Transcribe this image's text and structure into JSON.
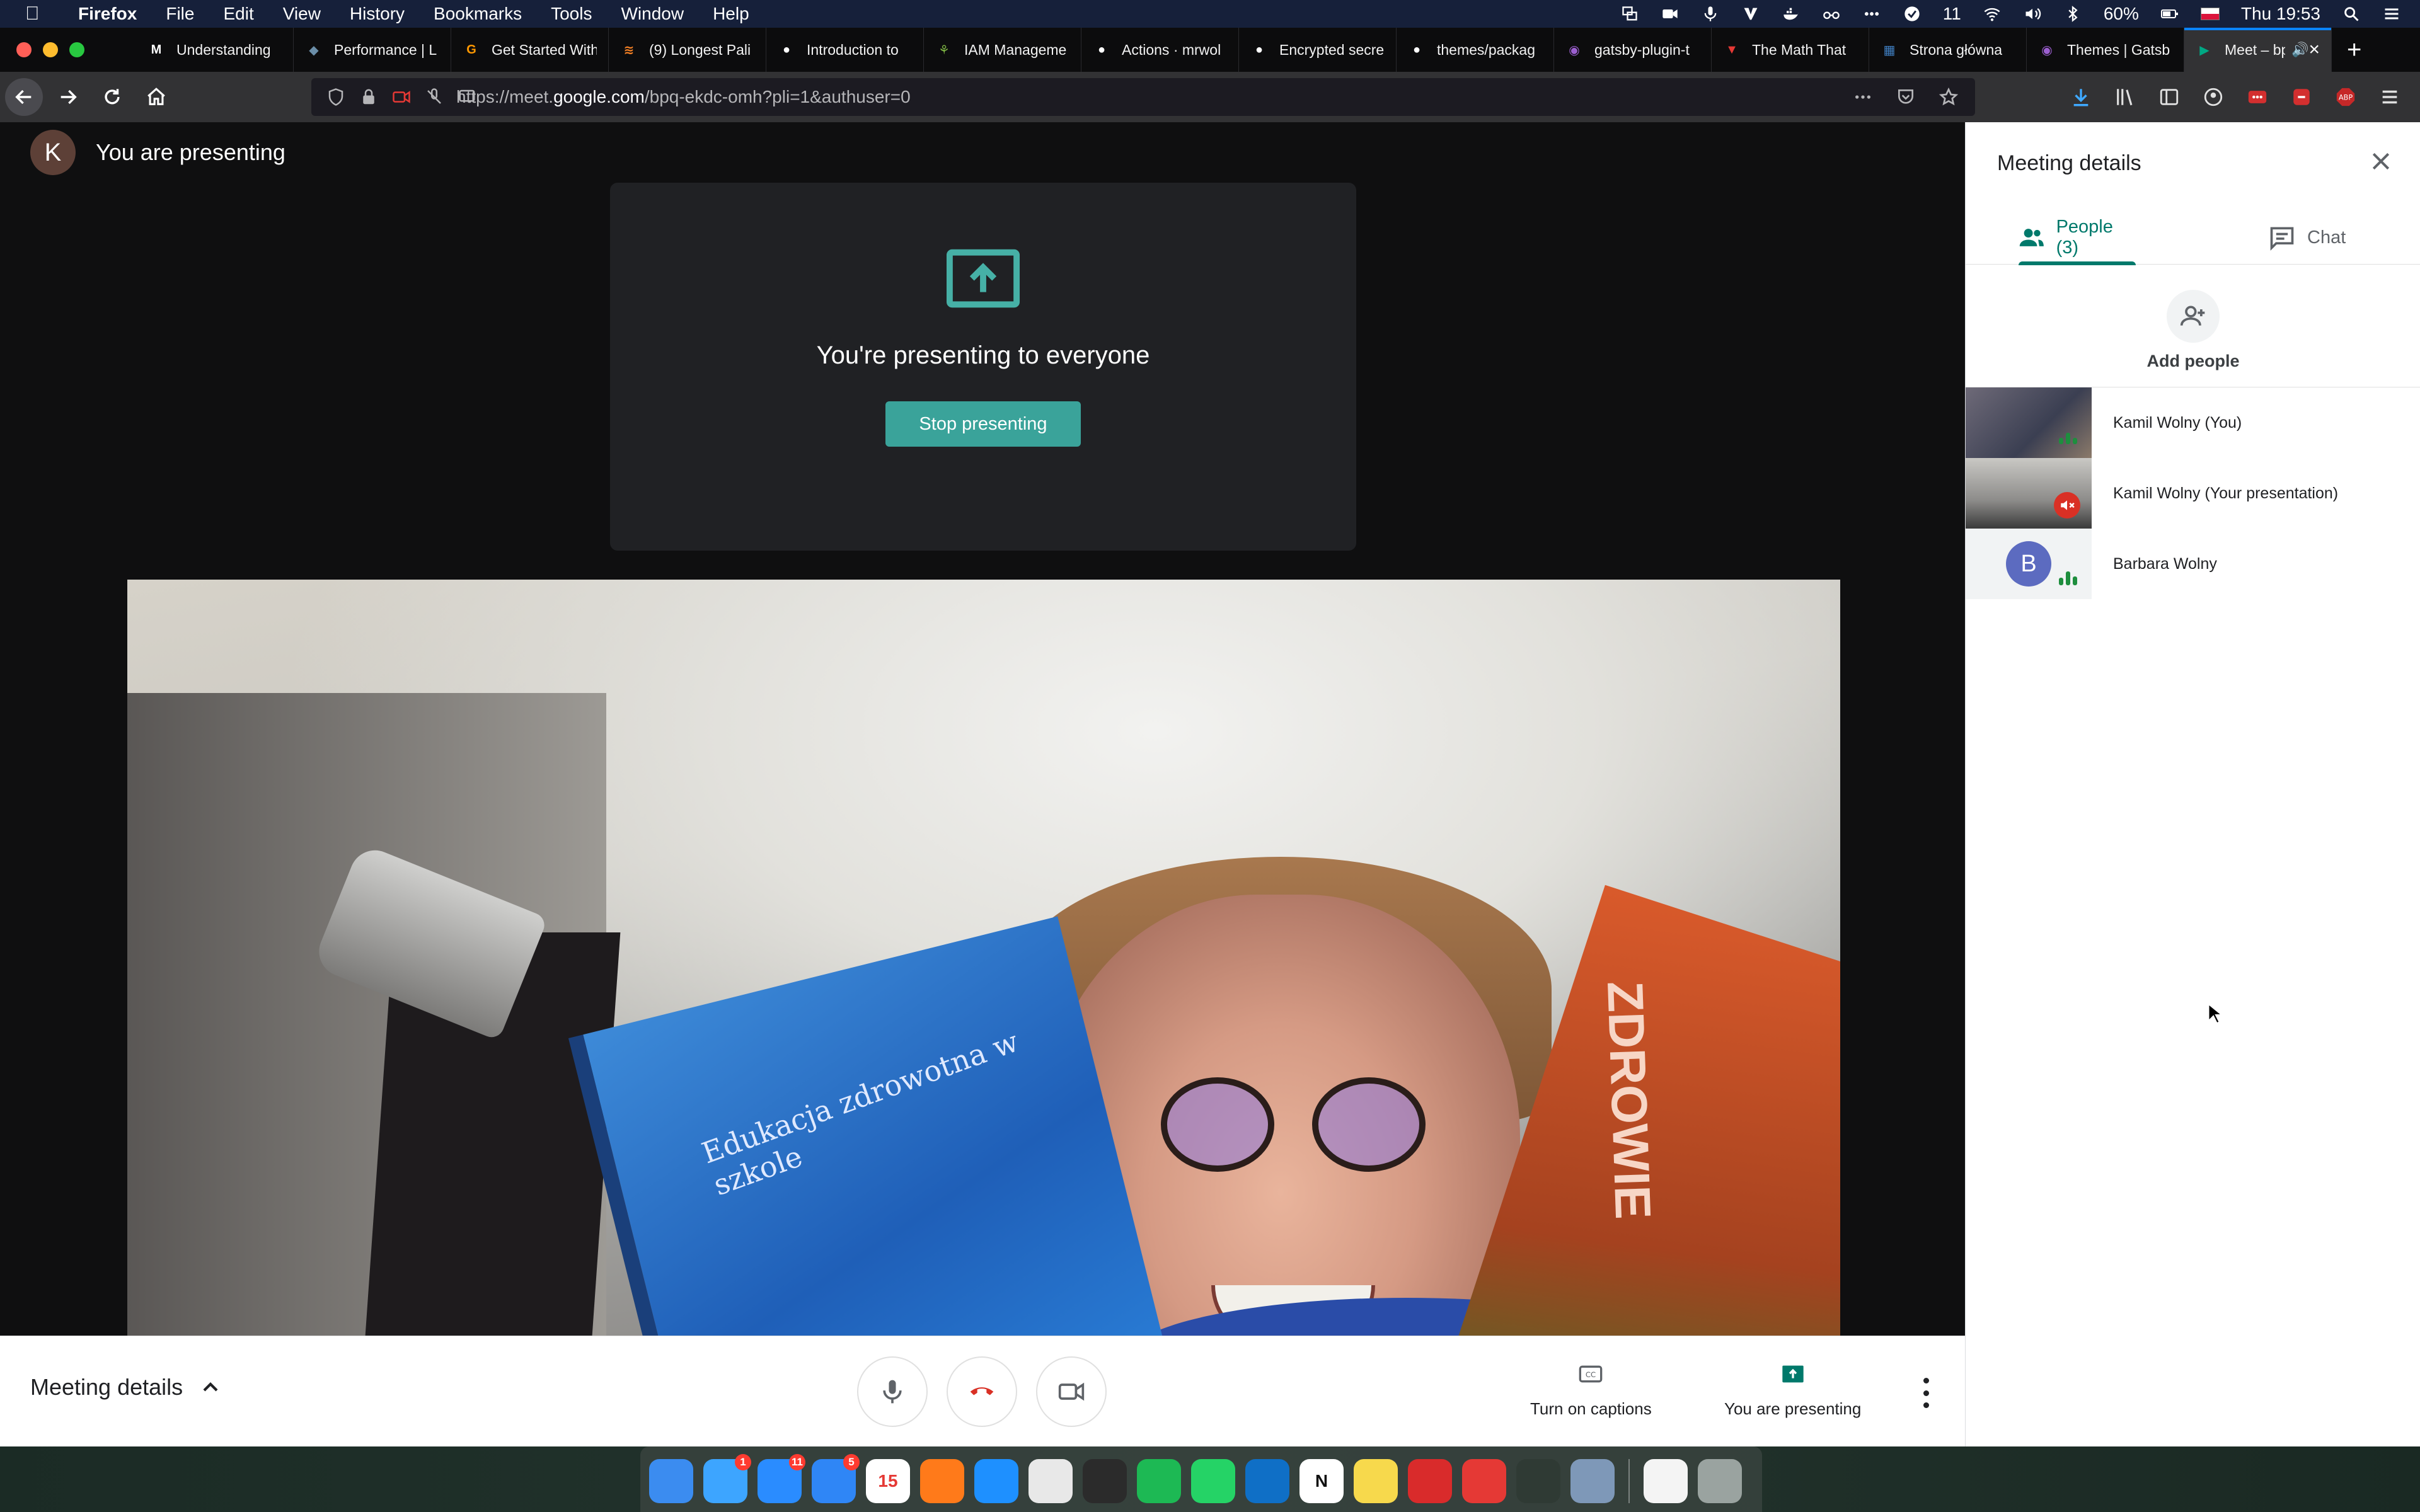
{
  "menubar": {
    "app": "Firefox",
    "items": [
      "File",
      "Edit",
      "View",
      "History",
      "Bookmarks",
      "Tools",
      "Window",
      "Help"
    ],
    "status": {
      "battery": "60%",
      "clock": "Thu 19:53",
      "notif_count": "11"
    }
  },
  "tabs": [
    {
      "label": "Understanding",
      "fav": "M",
      "color": "#ffffff"
    },
    {
      "label": "Performance | L",
      "fav": "◆",
      "color": "#6b8ea8"
    },
    {
      "label": "Get Started With",
      "fav": "G",
      "color": "#ff9800"
    },
    {
      "label": "(9) Longest Pali",
      "fav": "≋",
      "color": "#f48024"
    },
    {
      "label": "Introduction to",
      "fav": "●",
      "color": "#ffffff"
    },
    {
      "label": "IAM Manageme",
      "fav": "⚘",
      "color": "#7cb342"
    },
    {
      "label": "Actions · mrwol",
      "fav": "●",
      "color": "#ffffff"
    },
    {
      "label": "Encrypted secre",
      "fav": "●",
      "color": "#ffffff"
    },
    {
      "label": "themes/packag",
      "fav": "●",
      "color": "#ffffff"
    },
    {
      "label": "gatsby-plugin-t",
      "fav": "◉",
      "color": "#9c5fd0"
    },
    {
      "label": "The Math That",
      "fav": "▼",
      "color": "#e53935"
    },
    {
      "label": "Strona główna",
      "fav": "▦",
      "color": "#3f7ec0"
    },
    {
      "label": "Themes | Gatsb",
      "fav": "◉",
      "color": "#9c5fd0"
    },
    {
      "label": "Meet – bp",
      "fav": "▶",
      "color": "#00a884",
      "active": true
    }
  ],
  "url": {
    "prefix": "https://meet.",
    "domain": "google.com",
    "path": "/bpq-ekdc-omh?pli=1&authuser=0"
  },
  "meet": {
    "presenter_initial": "K",
    "presenter_text": "You are presenting",
    "card_text": "You're presenting to everyone",
    "stop_label": "Stop presenting",
    "book1_text": "Edukacja zdrowotna w szkole",
    "book2_text": "ZDROWIE"
  },
  "controls": {
    "meeting_details": "Meeting details",
    "captions": "Turn on captions",
    "presenting": "You are presenting"
  },
  "panel": {
    "title": "Meeting details",
    "tab_people": "People (3)",
    "tab_chat": "Chat",
    "add_people": "Add people",
    "participants": [
      {
        "name": "Kamil Wolny (You)"
      },
      {
        "name": "Kamil Wolny (Your presentation)"
      },
      {
        "name": "Barbara Wolny",
        "initial": "B"
      }
    ]
  },
  "dock": {
    "icons": [
      {
        "name": "finder",
        "color": "#3b8cf0"
      },
      {
        "name": "messages",
        "color": "#3da5ff",
        "badge": "1"
      },
      {
        "name": "mail",
        "color": "#2a8cff",
        "badge": "11"
      },
      {
        "name": "app-store",
        "color": "#2f86f6",
        "badge": "5"
      },
      {
        "name": "calendar",
        "color": "#ffffff",
        "text": "15"
      },
      {
        "name": "firefox",
        "color": "#ff7a1a"
      },
      {
        "name": "safari",
        "color": "#1e90ff"
      },
      {
        "name": "chrome",
        "color": "#e8e8e8"
      },
      {
        "name": "terminal",
        "color": "#2b2b2b"
      },
      {
        "name": "spotify",
        "color": "#1db954"
      },
      {
        "name": "whatsapp",
        "color": "#25d366"
      },
      {
        "name": "vscode",
        "color": "#0f6fc6"
      },
      {
        "name": "notion",
        "color": "#ffffff",
        "text": "N"
      },
      {
        "name": "stickies",
        "color": "#f7d94c"
      },
      {
        "name": "expressvpn",
        "color": "#d92b2b"
      },
      {
        "name": "more-app",
        "color": "#e53935"
      },
      {
        "name": "activity-monitor",
        "color": "#2f3a34"
      },
      {
        "name": "preview",
        "color": "#7e98b8"
      },
      {
        "name": "document",
        "color": "#f4f4f4"
      },
      {
        "name": "trash",
        "color": "#9aa3a0"
      }
    ]
  }
}
